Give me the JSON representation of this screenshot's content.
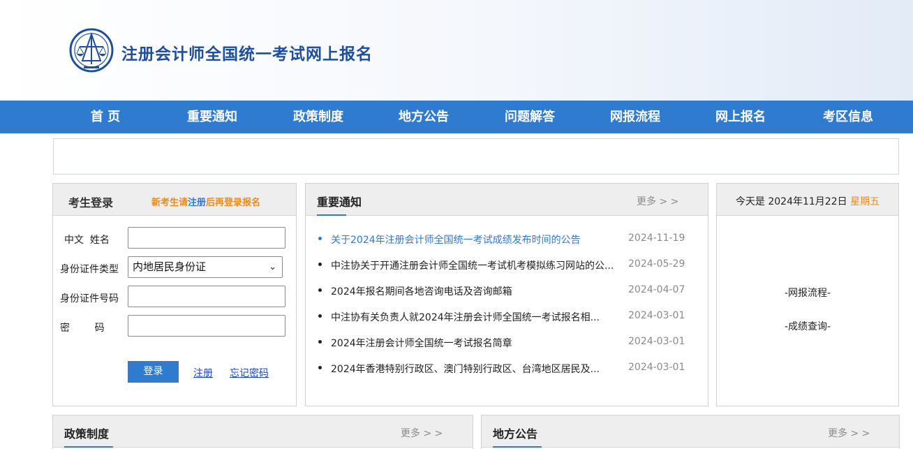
{
  "header": {
    "title": "注册会计师全国统一考试网上报名",
    "logo_icon": "cicpa-emblem-icon"
  },
  "nav": {
    "items": [
      {
        "label": "首  页"
      },
      {
        "label": "重要通知"
      },
      {
        "label": "政策制度"
      },
      {
        "label": "地方公告"
      },
      {
        "label": "问题解答"
      },
      {
        "label": "网报流程"
      },
      {
        "label": "网上报名"
      },
      {
        "label": "考区信息"
      }
    ]
  },
  "login": {
    "title": "考生登录",
    "hint_prefix": "新考生请",
    "hint_link": "注册",
    "hint_suffix": "后再登录报名",
    "name_label": "中文  姓名",
    "name_value": "",
    "idtype_label": "身份证件类型",
    "idtype_value": "内地居民身份证",
    "idno_label": "身份证件号码",
    "idno_value": "",
    "password_label": "密        码",
    "password_value": "",
    "login_button": "登录",
    "register_link": "注册",
    "forgot_link": "忘记密码"
  },
  "notices": {
    "title": "重要通知",
    "more": "更多 > >",
    "items": [
      {
        "text": "关于2024年注册会计师全国统一考试成绩发布时间的公告",
        "date": "2024-11-19"
      },
      {
        "text": "中注协关于开通注册会计师全国统一考试机考模拟练习网站的公...",
        "date": "2024-05-29"
      },
      {
        "text": "2024年报名期间各地咨询电话及咨询邮箱",
        "date": "2024-04-07"
      },
      {
        "text": "中注协有关负责人就2024年注册会计师全国统一考试报名相...",
        "date": "2024-03-01"
      },
      {
        "text": "2024年注册会计师全国统一考试报名简章",
        "date": "2024-03-01"
      },
      {
        "text": "2024年香港特别行政区、澳门特别行政区、台湾地区居民及...",
        "date": "2024-03-01"
      }
    ]
  },
  "today": {
    "prefix": "今天是 2024年11月22日",
    "weekday": "星期五",
    "link_process": "-网报流程-",
    "link_score": "-成绩查询-"
  },
  "policy": {
    "title": "政策制度",
    "more": "更多 > >"
  },
  "local": {
    "title": "地方公告",
    "more": "更多 > >"
  },
  "colors": {
    "nav_bg": "#2f7bd0",
    "title": "#1f4f9c",
    "accent_orange": "#f08a1c",
    "link": "#1d47c8"
  }
}
